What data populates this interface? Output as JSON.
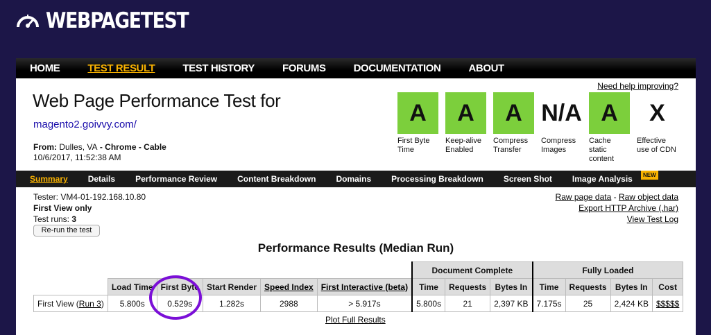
{
  "brand": {
    "logo_text": "WEBPAGETEST"
  },
  "nav": [
    {
      "label": "HOME",
      "active": false
    },
    {
      "label": "TEST RESULT",
      "active": true
    },
    {
      "label": "TEST HISTORY",
      "active": false
    },
    {
      "label": "FORUMS",
      "active": false
    },
    {
      "label": "DOCUMENTATION",
      "active": false
    },
    {
      "label": "ABOUT",
      "active": false
    }
  ],
  "help_link": "Need help improving?",
  "title": "Web Page Performance Test for",
  "url": "magento2.goivvy.com/",
  "from": {
    "label": "From:",
    "location": "Dulles, VA",
    "browser": "Chrome",
    "connection": "Cable",
    "sep": " - "
  },
  "date": "10/6/2017, 11:52:38 AM",
  "grades": [
    {
      "grade": "A",
      "label": "First Byte Time",
      "green": true
    },
    {
      "grade": "A",
      "label": "Keep-alive Enabled",
      "green": true
    },
    {
      "grade": "A",
      "label": "Compress Transfer",
      "green": true
    },
    {
      "grade": "N/A",
      "label": "Compress Images",
      "green": false
    },
    {
      "grade": "A",
      "label": "Cache static content",
      "green": true
    },
    {
      "grade": "X",
      "label": "Effective use of CDN",
      "green": false
    }
  ],
  "subnav": [
    "Summary",
    "Details",
    "Performance Review",
    "Content Breakdown",
    "Domains",
    "Processing Breakdown",
    "Screen Shot",
    "Image Analysis"
  ],
  "new_badge": "NEW",
  "tester": {
    "tester_line": "Tester: VM4-01-192.168.10.80",
    "view": "First View only",
    "runs_label": "Test runs:",
    "runs_value": "3",
    "rerun_label": "Re-run the test"
  },
  "links": {
    "raw_page": "Raw page data",
    "sep": " - ",
    "raw_object": "Raw object data",
    "export_har": "Export HTTP Archive (.har)",
    "test_log": "View Test Log"
  },
  "results": {
    "title": "Performance Results (Median Run)",
    "group_doc": "Document Complete",
    "group_full": "Fully Loaded",
    "headers": {
      "load_time": "Load Time",
      "first_byte": "First Byte",
      "start_render": "Start Render",
      "speed_index": "Speed Index",
      "first_interactive": "First Interactive (beta)",
      "doc_time": "Time",
      "doc_requests": "Requests",
      "doc_bytes": "Bytes In",
      "full_time": "Time",
      "full_requests": "Requests",
      "full_bytes": "Bytes In",
      "cost": "Cost"
    },
    "row": {
      "label": "First View (",
      "run_link": "Run 3",
      "label_end": ")",
      "load_time": "5.800s",
      "first_byte": "0.529s",
      "start_render": "1.282s",
      "speed_index": "2988",
      "first_interactive": "> 5.917s",
      "doc_time": "5.800s",
      "doc_requests": "21",
      "doc_bytes": "2,397 KB",
      "full_time": "7.175s",
      "full_requests": "25",
      "full_bytes": "2,424 KB",
      "cost": "$$$$$"
    },
    "plot_link": "Plot Full Results"
  }
}
